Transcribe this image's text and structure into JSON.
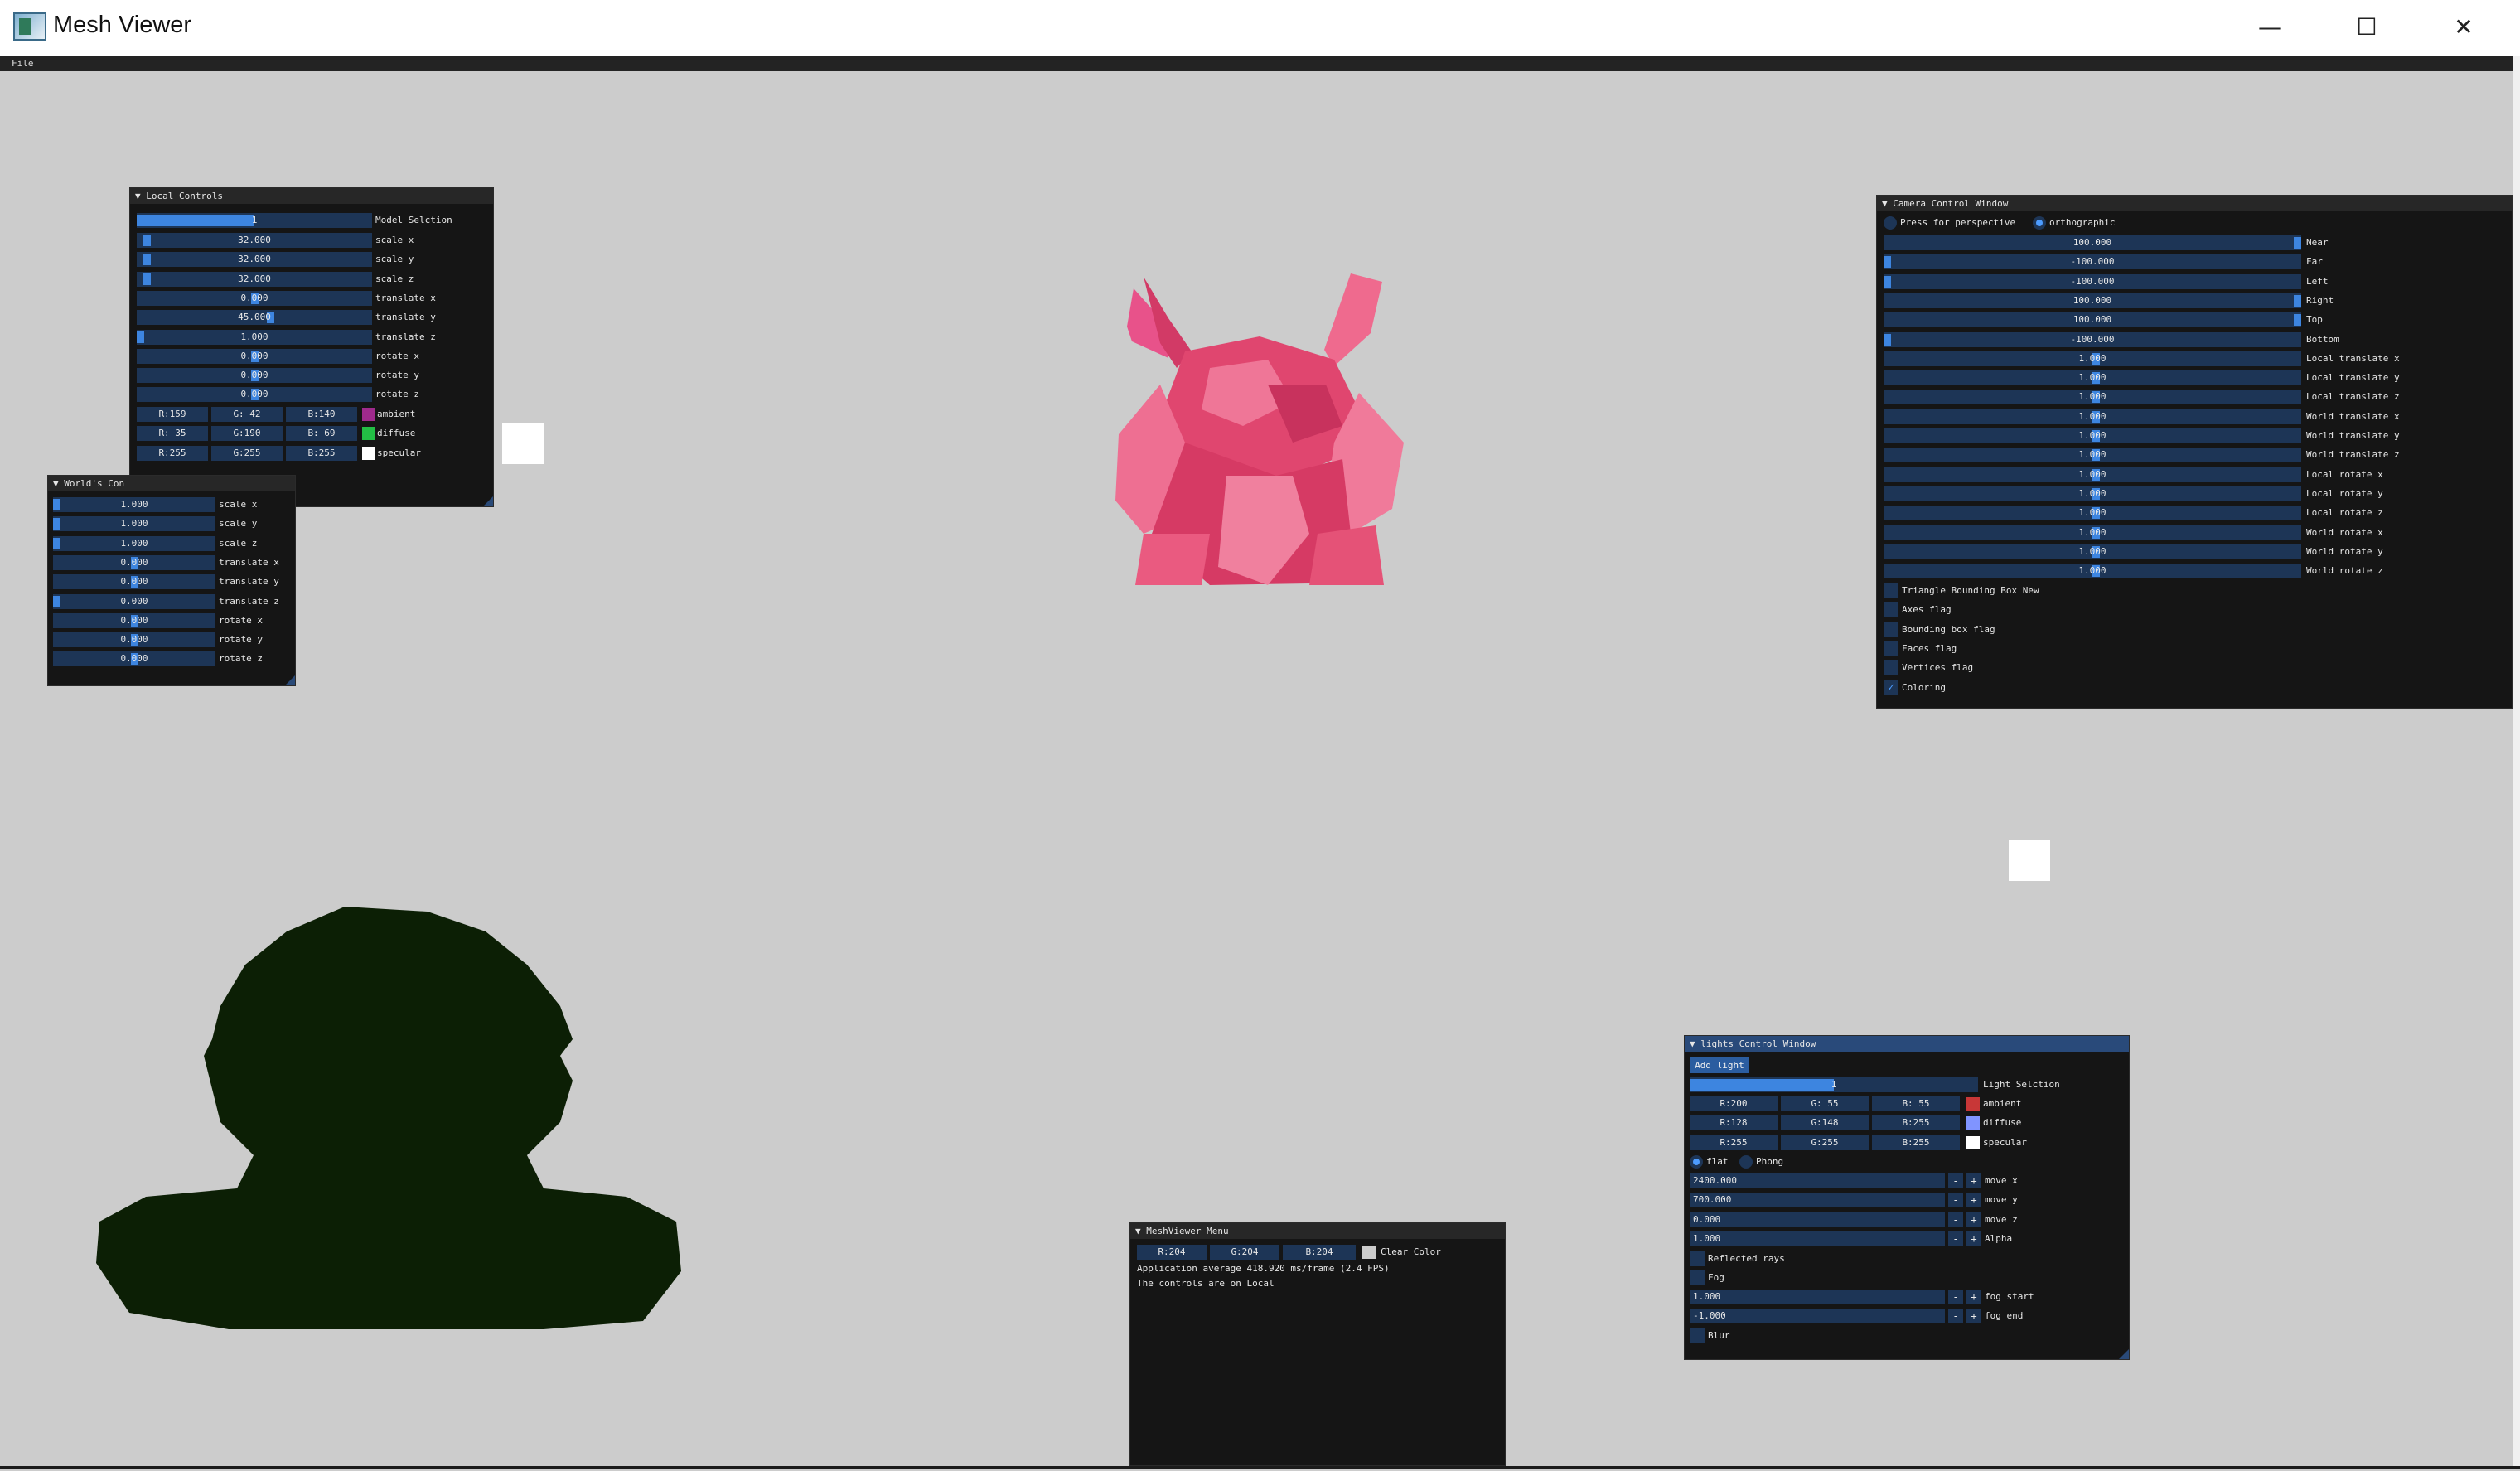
{
  "window": {
    "title": "Mesh Viewer",
    "min_icon": "minimize-icon",
    "max_icon": "maximize-icon",
    "close_icon": "close-icon"
  },
  "menu": {
    "file": "File"
  },
  "local": {
    "title": "Local Controls",
    "model_label": "Model Selction",
    "model_value": "1",
    "rows": [
      {
        "v": "32.000",
        "l": "scale x",
        "f": 0.03
      },
      {
        "v": "32.000",
        "l": "scale y",
        "f": 0.03
      },
      {
        "v": "32.000",
        "l": "scale z",
        "f": 0.03
      },
      {
        "v": "0.000",
        "l": "translate x",
        "f": 0.5
      },
      {
        "v": "45.000",
        "l": "translate y",
        "f": 0.57
      },
      {
        "v": "1.000",
        "l": "translate z",
        "f": 0.0
      },
      {
        "v": "0.000",
        "l": "rotate x",
        "f": 0.5
      },
      {
        "v": "0.000",
        "l": "rotate y",
        "f": 0.5
      },
      {
        "v": "0.000",
        "l": "rotate z",
        "f": 0.5
      }
    ],
    "colors": [
      {
        "r": "R:159",
        "g": "G: 42",
        "b": "B:140",
        "l": "ambient",
        "c": "#9f2a8c"
      },
      {
        "r": "R: 35",
        "g": "G:190",
        "b": "B: 69",
        "l": "diffuse",
        "c": "#23be45"
      },
      {
        "r": "R:255",
        "g": "G:255",
        "b": "B:255",
        "l": "specular",
        "c": "#ffffff"
      }
    ]
  },
  "world": {
    "title": "World's Con",
    "rows": [
      {
        "v": "1.000",
        "l": "scale x",
        "f": 0.0
      },
      {
        "v": "1.000",
        "l": "scale y",
        "f": 0.0
      },
      {
        "v": "1.000",
        "l": "scale z",
        "f": 0.0
      },
      {
        "v": "0.000",
        "l": "translate x",
        "f": 0.5
      },
      {
        "v": "0.000",
        "l": "translate y",
        "f": 0.5
      },
      {
        "v": "0.000",
        "l": "translate z",
        "f": 0.0
      },
      {
        "v": "0.000",
        "l": "rotate x",
        "f": 0.5
      },
      {
        "v": "0.000",
        "l": "rotate y",
        "f": 0.5
      },
      {
        "v": "0.000",
        "l": "rotate z",
        "f": 0.5
      }
    ]
  },
  "camera": {
    "title": "Camera Control Window",
    "perspective": "Press for perspective",
    "ortho": "orthographic",
    "rows": [
      {
        "v": "100.000",
        "l": "Near",
        "f": 1.0
      },
      {
        "v": "-100.000",
        "l": "Far",
        "f": 0.0
      },
      {
        "v": "-100.000",
        "l": "Left",
        "f": 0.0
      },
      {
        "v": "100.000",
        "l": "Right",
        "f": 1.0
      },
      {
        "v": "100.000",
        "l": "Top",
        "f": 1.0
      },
      {
        "v": "-100.000",
        "l": "Bottom",
        "f": 0.0
      },
      {
        "v": "1.000",
        "l": "Local translate x",
        "f": 0.51
      },
      {
        "v": "1.000",
        "l": "Local translate y",
        "f": 0.51
      },
      {
        "v": "1.000",
        "l": "Local translate z",
        "f": 0.51
      },
      {
        "v": "1.000",
        "l": "World translate x",
        "f": 0.51
      },
      {
        "v": "1.000",
        "l": "World translate y",
        "f": 0.51
      },
      {
        "v": "1.000",
        "l": "World translate z",
        "f": 0.51
      },
      {
        "v": "1.000",
        "l": "Local rotate x",
        "f": 0.51
      },
      {
        "v": "1.000",
        "l": "Local rotate y",
        "f": 0.51
      },
      {
        "v": "1.000",
        "l": "Local rotate z",
        "f": 0.51
      },
      {
        "v": "1.000",
        "l": "World rotate x",
        "f": 0.51
      },
      {
        "v": "1.000",
        "l": "World rotate y",
        "f": 0.51
      },
      {
        "v": "1.000",
        "l": "World rotate z",
        "f": 0.51
      }
    ],
    "checks": [
      {
        "l": "Triangle Bounding Box New",
        "on": false
      },
      {
        "l": "Axes flag",
        "on": false
      },
      {
        "l": "Bounding box flag",
        "on": false
      },
      {
        "l": "Faces flag",
        "on": false
      },
      {
        "l": "Vertices flag",
        "on": false
      },
      {
        "l": "Coloring",
        "on": true
      }
    ]
  },
  "lights": {
    "title": "lights Control Window",
    "add_light": "Add light",
    "sel_label": "Light Selction",
    "sel_value": "1",
    "colors": [
      {
        "r": "R:200",
        "g": "G: 55",
        "b": "B: 55",
        "l": "ambient",
        "c": "#c83737"
      },
      {
        "r": "R:128",
        "g": "G:148",
        "b": "B:255",
        "l": "diffuse",
        "c": "#8094ff"
      },
      {
        "r": "R:255",
        "g": "G:255",
        "b": "B:255",
        "l": "specular",
        "c": "#ffffff"
      }
    ],
    "flat": "flat",
    "phong": "Phong",
    "moves": [
      {
        "v": "2400.000",
        "l": "move x"
      },
      {
        "v": "700.000",
        "l": "move y"
      },
      {
        "v": "0.000",
        "l": "move z"
      },
      {
        "v": "1.000",
        "l": "Alpha"
      }
    ],
    "reflected": "Reflected rays",
    "fog": "Fog",
    "fogs": [
      {
        "v": "1.000",
        "l": "fog start"
      },
      {
        "v": "-1.000",
        "l": "fog end"
      }
    ],
    "blur": "Blur",
    "minus": "-",
    "plus": "+"
  },
  "menuwin": {
    "title": "MeshViewer Menu",
    "r": "R:204",
    "g": "G:204",
    "b": "B:204",
    "clear": "Clear Color",
    "clear_color": "#cccccc",
    "fps": "Application average 418.920 ms/frame (2.4 FPS)",
    "controls": "The controls are on Local"
  },
  "scene": {
    "bunny_color": "#e34a72",
    "bust_color": "#0c1f05"
  }
}
